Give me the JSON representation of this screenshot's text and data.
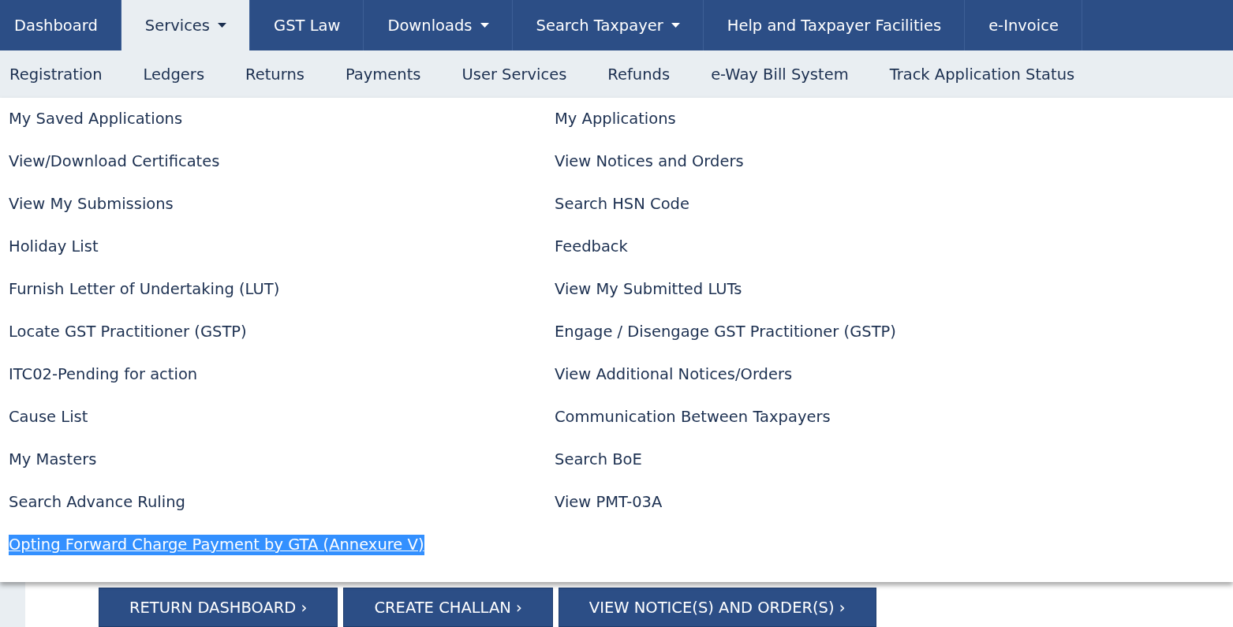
{
  "top_nav": [
    {
      "label": "Dashboard",
      "selected": false,
      "dropdown": false
    },
    {
      "label": "Services",
      "selected": true,
      "dropdown": true
    },
    {
      "label": "GST Law",
      "selected": false,
      "dropdown": false
    },
    {
      "label": "Downloads",
      "selected": false,
      "dropdown": true
    },
    {
      "label": "Search Taxpayer",
      "selected": false,
      "dropdown": true
    },
    {
      "label": "Help and Taxpayer Facilities",
      "selected": false,
      "dropdown": false
    },
    {
      "label": "e-Invoice",
      "selected": false,
      "dropdown": false
    }
  ],
  "sub_nav": [
    "Registration",
    "Ledgers",
    "Returns",
    "Payments",
    "User Services",
    "Refunds",
    "e-Way Bill System",
    "Track Application Status"
  ],
  "menu_columns": [
    [
      {
        "label": "My Saved Applications",
        "selected": false
      },
      {
        "label": "View/Download Certificates",
        "selected": false
      },
      {
        "label": "View My Submissions",
        "selected": false
      },
      {
        "label": "Holiday List",
        "selected": false
      },
      {
        "label": "Furnish Letter of Undertaking (LUT)",
        "selected": false
      },
      {
        "label": "Locate GST Practitioner (GSTP)",
        "selected": false
      },
      {
        "label": "ITC02-Pending for action",
        "selected": false
      },
      {
        "label": "Cause List",
        "selected": false
      },
      {
        "label": "My Masters",
        "selected": false
      },
      {
        "label": "Search Advance Ruling",
        "selected": false
      },
      {
        "label": "Opting Forward Charge Payment by GTA (Annexure V)",
        "selected": true
      }
    ],
    [
      {
        "label": "My Applications",
        "selected": false
      },
      {
        "label": "View Notices and Orders",
        "selected": false
      },
      {
        "label": "Search HSN Code",
        "selected": false
      },
      {
        "label": "Feedback",
        "selected": false
      },
      {
        "label": "View My Submitted LUTs",
        "selected": false
      },
      {
        "label": "Engage / Disengage GST Practitioner (GSTP)",
        "selected": false
      },
      {
        "label": "View Additional Notices/Orders",
        "selected": false
      },
      {
        "label": "Communication Between Taxpayers",
        "selected": false
      },
      {
        "label": "Search BoE",
        "selected": false
      },
      {
        "label": "View PMT-03A",
        "selected": false
      }
    ]
  ],
  "buttons": [
    "RETURN DASHBOARD ›",
    "CREATE CHALLAN ›",
    "VIEW NOTICE(S) AND ORDER(S) ›"
  ]
}
